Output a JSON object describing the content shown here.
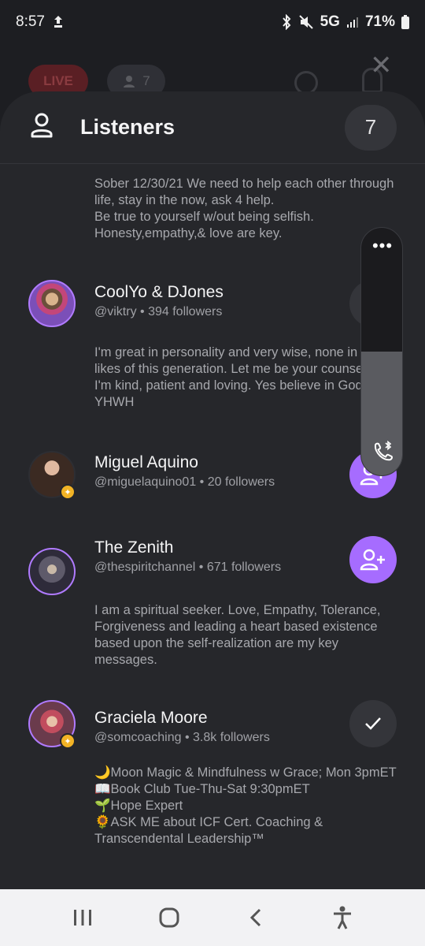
{
  "status_bar": {
    "time": "8:57",
    "network": "5G",
    "battery": "71%"
  },
  "background_room": {
    "live_label": "LIVE",
    "listener_count": "7"
  },
  "sheet": {
    "title": "Listeners",
    "count": "7"
  },
  "listeners": [
    {
      "bio": "Sober 12/30/21 We need to help each other through life, stay in the now, ask 4 help.\nBe true to yourself w/out being selfish.\nHonesty,empathy,& love are key."
    },
    {
      "name": "CoolYo & DJones",
      "handle": "@viktry",
      "followers": "394 followers",
      "bio": "I'm great in personality and very wise, none in the likes of this generation. Let me be your counsellor. I'm kind, patient and loving. Yes believe in God YHWH"
    },
    {
      "name": "Miguel Aquino",
      "handle": "@miguelaquino01",
      "followers": "20 followers",
      "bio": ""
    },
    {
      "name": "The Zenith",
      "handle": "@thespiritchannel",
      "followers": "671 followers",
      "bio": "I am a spiritual seeker. Love, Empathy, Tolerance, Forgiveness and leading a heart based existence based upon the self-realization are my key messages."
    },
    {
      "name": "Graciela Moore",
      "handle": "@somcoaching",
      "followers": "3.8k followers",
      "bio": "🌙Moon Magic & Mindfulness w Grace; Mon 3pmET\n📖Book Club Tue-Thu-Sat 9:30pmET\n🌱Hope Expert\n🌻ASK ME about ICF Cert. Coaching & Transcendental Leadership™"
    }
  ],
  "separator": " • ",
  "volume_panel": {
    "more_label": "•••",
    "level": 0.5
  },
  "colors": {
    "accent": "#a66cff",
    "sheet_bg": "#26272b",
    "live_red": "#5a1f24"
  },
  "icons": {
    "listeners": "person-icon",
    "follow": "add-user-icon",
    "followed": "check-icon",
    "bluetooth_call": "bluetooth-call-icon",
    "nav_recents": "recents-icon",
    "nav_home": "home-icon",
    "nav_back": "back-icon",
    "nav_accessibility": "accessibility-icon"
  }
}
